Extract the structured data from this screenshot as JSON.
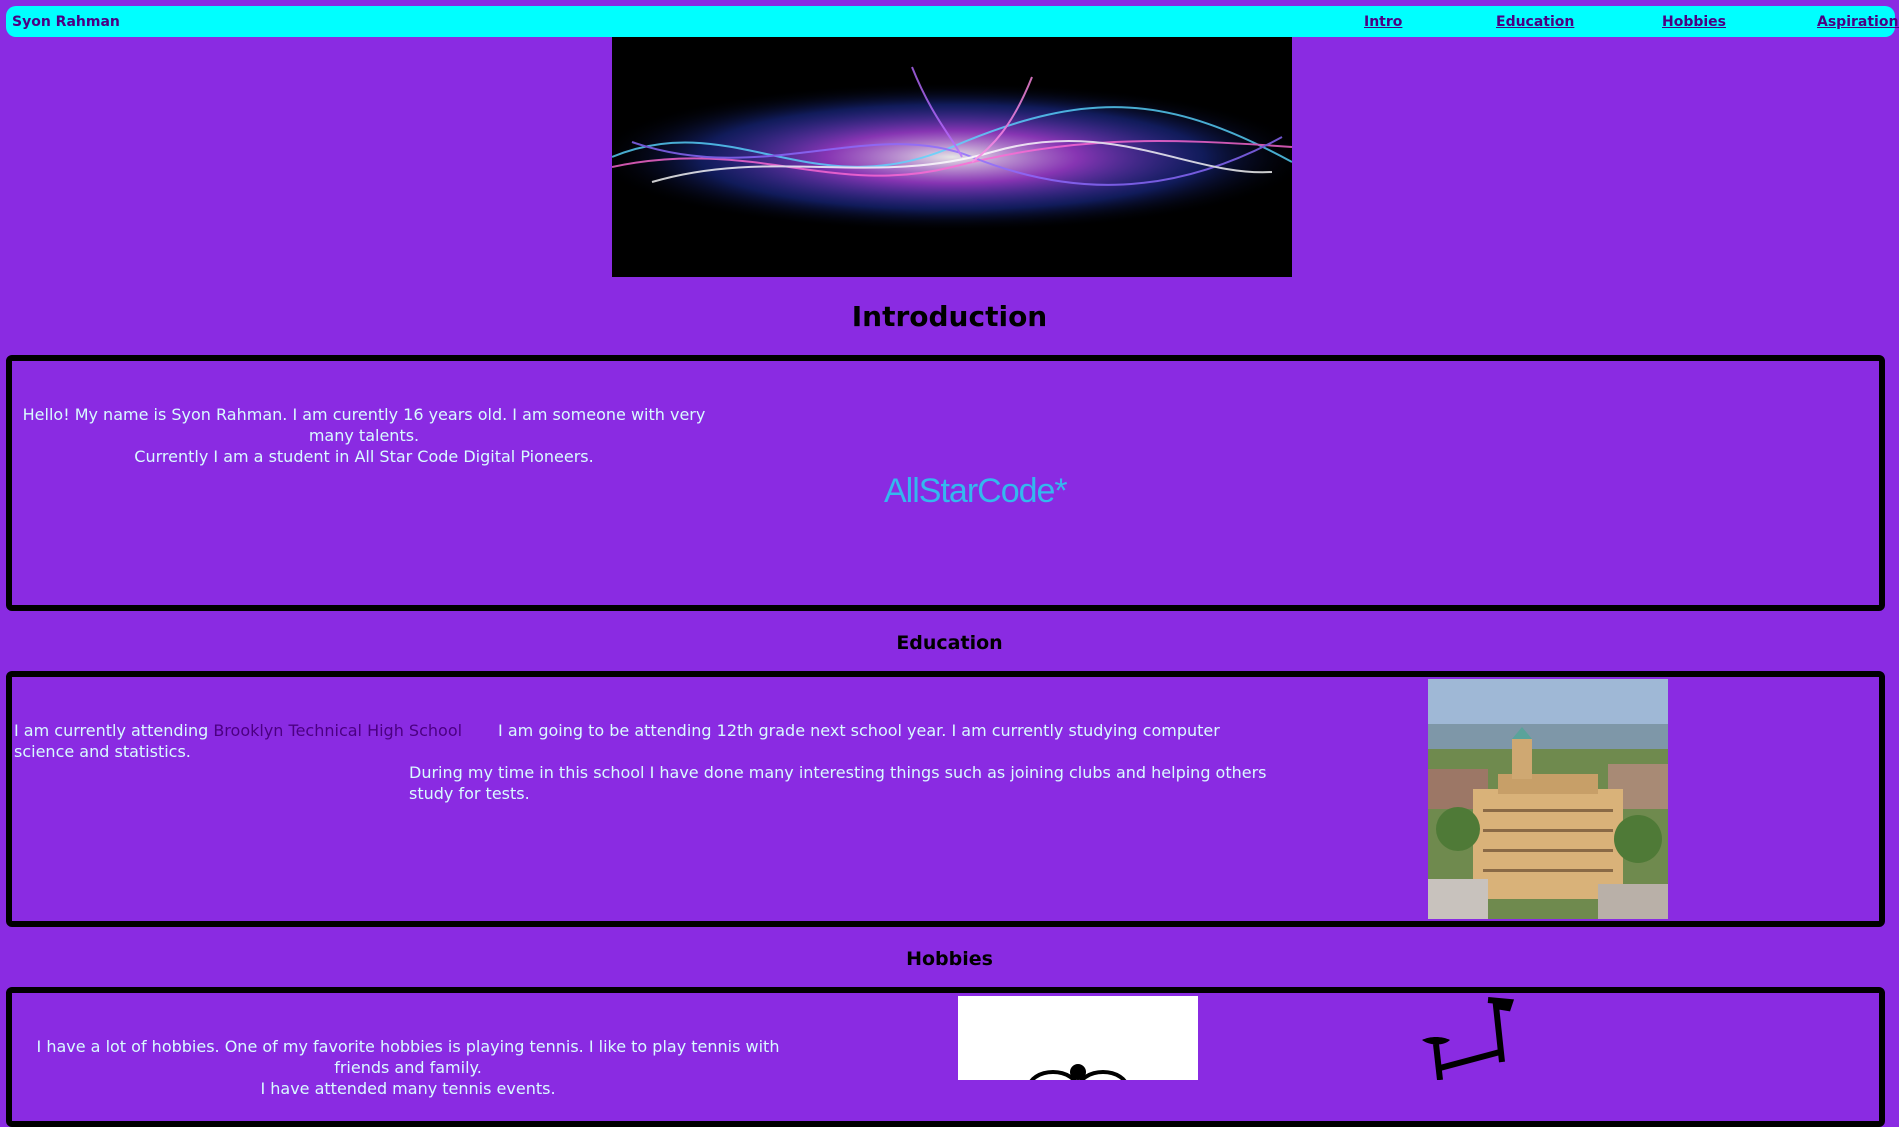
{
  "nav": {
    "brand": "Syon Rahman",
    "links": [
      "Intro",
      "Education",
      "Hobbies",
      "Aspirations"
    ]
  },
  "intro": {
    "title": "Introduction",
    "line1": "Hello! My name is Syon Rahman. I am curently 16 years old. I am someone with very many talents.",
    "line2": "Currently I am a student in All Star Code Digital Pioneers.",
    "logo_text": "AllStarCode*"
  },
  "education": {
    "title": "Education",
    "prefix": "I am currently attending ",
    "school_link": "Brooklyn Technical High School",
    "line1_rest": "I am going to be attending 12th grade next school year. I am currently studying computer science and statistics.",
    "line2": "During my time in this school I have done many interesting things such as joining clubs and helping others study for tests."
  },
  "hobbies": {
    "title": "Hobbies",
    "line1": "I have a lot of hobbies. One of my favorite hobbies is playing tennis. I like to play tennis with friends and family.",
    "line2": "I have attended many tennis events."
  },
  "colors": {
    "background": "#8a2be2",
    "navbar": "#00ffff",
    "text": "#d9fbff",
    "logo": "#34b8ee"
  }
}
